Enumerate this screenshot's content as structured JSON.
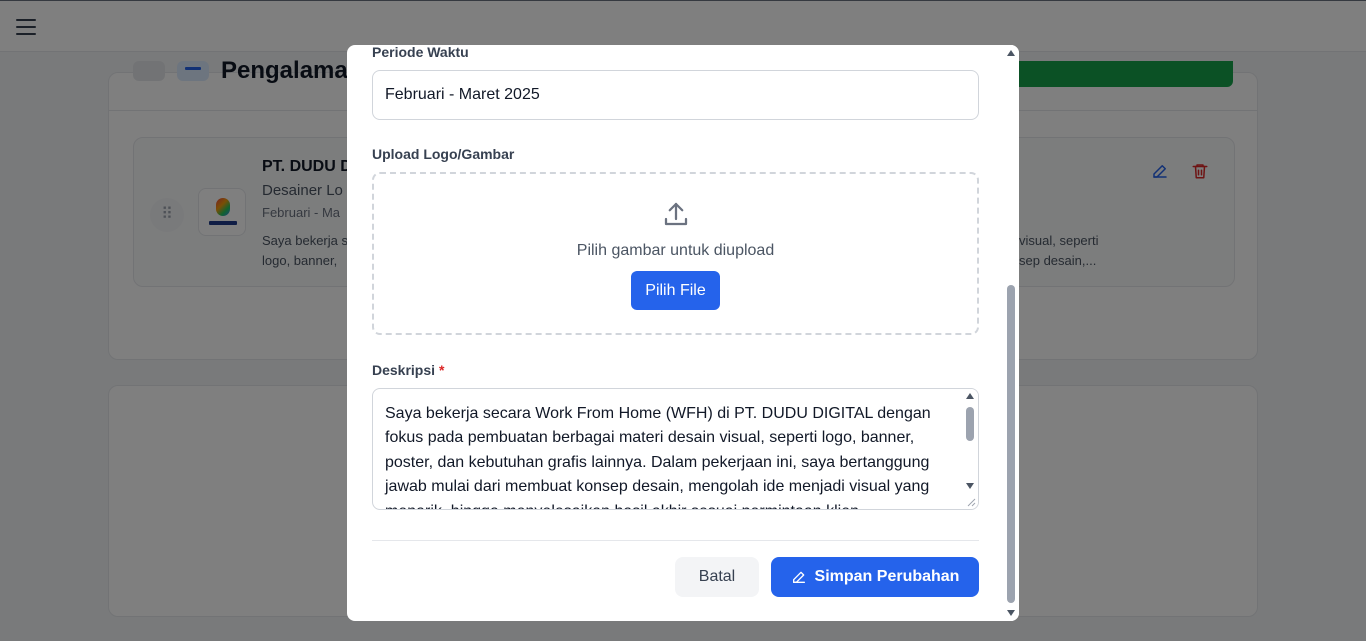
{
  "background": {
    "section_title": "Pengalaman",
    "experience": {
      "company": "PT. DUDU D",
      "role": "Desainer Lo",
      "period": "Februari - Ma",
      "desc_left_1": "Saya bekerja s",
      "desc_left_2": "logo, banner,",
      "desc_right_1": "visual, seperti",
      "desc_right_2": "sep desain,..."
    }
  },
  "modal": {
    "period_label": "Periode Waktu",
    "period_value": "Februari - Maret 2025",
    "upload_label": "Upload Logo/Gambar",
    "upload_hint": "Pilih gambar untuk diupload",
    "pick_file_label": "Pilih File",
    "description_label": "Deskripsi",
    "required_mark": "*",
    "description_text": "Saya bekerja secara Work From Home (WFH) di PT. DUDU DIGITAL dengan fokus pada pembuatan berbagai materi desain visual, seperti logo, banner, poster, dan kebutuhan grafis lainnya. Dalam pekerjaan ini, saya bertanggung jawab mulai dari membuat konsep desain, mengolah ide menjadi visual yang menarik, hingga menyelesaikan hasil akhir sesuai permintaan klien.",
    "cancel_label": "Batal",
    "save_label": "Simpan Perubahan"
  },
  "colors": {
    "primary": "#2563eb",
    "success": "#16a34a",
    "danger": "#dc2626"
  }
}
